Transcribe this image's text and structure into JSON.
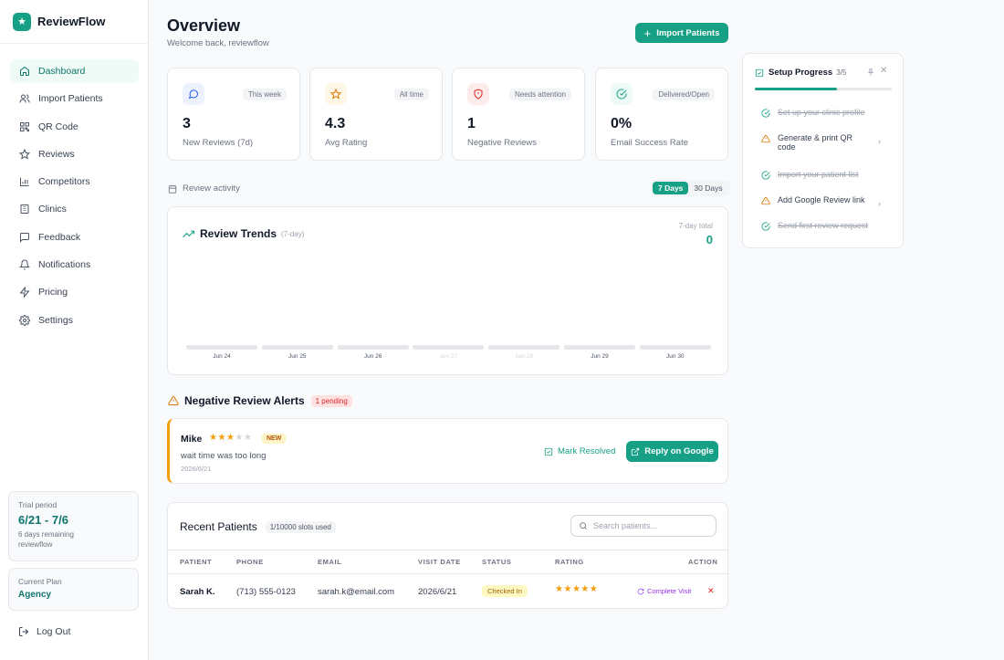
{
  "app": {
    "name": "ReviewFlow"
  },
  "sidebar": {
    "items": [
      {
        "label": "Dashboard",
        "icon": "home-icon",
        "active": true
      },
      {
        "label": "Import Patients",
        "icon": "users-icon",
        "active": false
      },
      {
        "label": "QR Code",
        "icon": "qr-icon",
        "active": false
      },
      {
        "label": "Reviews",
        "icon": "star-icon",
        "active": false
      },
      {
        "label": "Competitors",
        "icon": "bar-chart-icon",
        "active": false
      },
      {
        "label": "Clinics",
        "icon": "building-icon",
        "active": false
      },
      {
        "label": "Feedback",
        "icon": "message-icon",
        "active": false
      },
      {
        "label": "Notifications",
        "icon": "bell-icon",
        "active": false
      },
      {
        "label": "Pricing",
        "icon": "zap-icon",
        "active": false
      },
      {
        "label": "Settings",
        "icon": "gear-icon",
        "active": false
      }
    ],
    "trial": {
      "label": "Trial period",
      "dates": "6/21 - 7/6",
      "remaining": "6 days remaining",
      "user": "reviewflow"
    },
    "plan": {
      "label": "Current Plan",
      "name": "Agency"
    },
    "logout": "Log Out"
  },
  "header": {
    "title": "Overview",
    "subtitle": "Welcome back, reviewflow",
    "import_button": "Import Patients"
  },
  "stats": [
    {
      "value": "3",
      "label": "New Reviews (7d)",
      "badge": "This week",
      "icon": "message-circle-icon",
      "accent": "#2563eb",
      "bg": "#eef2ff"
    },
    {
      "value": "4.3",
      "label": "Avg Rating",
      "badge": "All time",
      "icon": "star-icon",
      "accent": "#d97706",
      "bg": "#fef7e6"
    },
    {
      "value": "1",
      "label": "Negative Reviews",
      "badge": "Needs attention",
      "icon": "shield-alert-icon",
      "accent": "#dc2626",
      "bg": "#fdecec"
    },
    {
      "value": "0%",
      "label": "Email Success Rate",
      "badge": "Delivered/Open",
      "icon": "check-circle-icon",
      "accent": "#16a085",
      "bg": "#ecfbf5"
    }
  ],
  "activity": {
    "label": "Review activity",
    "ranges": [
      "7 Days",
      "30 Days"
    ],
    "active_range": "7 Days"
  },
  "trends": {
    "title": "Review Trends",
    "subtitle": "(7-day)",
    "total_label": "7-day total",
    "total": "0",
    "days": [
      "Jun 24",
      "Jun 25",
      "Jun 26",
      "Jun 27",
      "Jun 28",
      "Jun 29",
      "Jun 30"
    ],
    "faded_days": [
      3,
      4
    ]
  },
  "alerts": {
    "title": "Negative Review Alerts",
    "pending": "1 pending",
    "items": [
      {
        "name": "Mike",
        "rating": 3,
        "max": 5,
        "badge": "NEW",
        "text": "wait time was too long",
        "date": "2026/6/21",
        "resolve": "Mark Resolved",
        "reply": "Reply on Google"
      }
    ]
  },
  "patients": {
    "title": "Recent Patients",
    "slots": "1/10000 slots used",
    "search_placeholder": "Search patients...",
    "columns": [
      "PATIENT",
      "PHONE",
      "EMAIL",
      "VISIT DATE",
      "STATUS",
      "RATING",
      "ACTION"
    ],
    "rows": [
      {
        "patient": "Sarah K.",
        "phone": "(713) 555-0123",
        "email": "sarah.k@email.com",
        "visit_date": "2026/6/21",
        "status": "Checked In",
        "rating": 5,
        "action": "Complete Visit"
      }
    ]
  },
  "setup": {
    "title": "Setup Progress",
    "count": "3/5",
    "progress": 0.6,
    "steps": [
      {
        "label": "Set up your clinic profile",
        "done": true
      },
      {
        "label": "Generate & print QR code",
        "done": false
      },
      {
        "label": "Import your patient list",
        "done": true
      },
      {
        "label": "Add Google Review link",
        "done": false
      },
      {
        "label": "Send first review request",
        "done": true
      }
    ]
  }
}
